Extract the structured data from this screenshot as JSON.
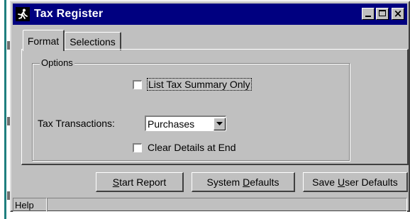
{
  "window": {
    "title": "Tax Register",
    "icon": "running-man-icon",
    "controls": [
      "minimize",
      "maximize",
      "close"
    ]
  },
  "tabs": [
    {
      "label": "Format",
      "active": true
    },
    {
      "label": "Selections",
      "active": false
    }
  ],
  "options": {
    "group_label": "Options",
    "list_summary": {
      "label": "List Tax Summary Only",
      "checked": false
    },
    "tax_transactions": {
      "label": "Tax Transactions:",
      "value": "Purchases"
    },
    "clear_details": {
      "label": "Clear Details at End",
      "checked": false
    }
  },
  "buttons": {
    "start_report": {
      "pre": "",
      "u": "S",
      "post": "tart Report"
    },
    "system_defaults": {
      "pre": "System ",
      "u": "D",
      "post": "efaults"
    },
    "save_user_defaults": {
      "pre": "Save ",
      "u": "U",
      "post": "ser Defaults"
    }
  },
  "status": {
    "help": "Help"
  },
  "colors": {
    "titlebar": "#000080",
    "face": "#c0c0c0",
    "background_strip": "#1f7f7f"
  }
}
